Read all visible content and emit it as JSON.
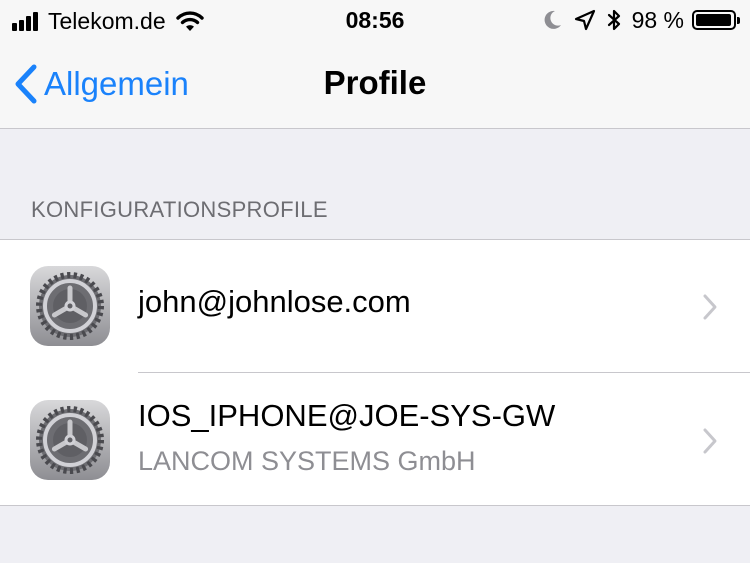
{
  "status_bar": {
    "carrier": "Telekom.de",
    "time": "08:56",
    "battery_percent": "98 %",
    "battery_level": 0.98,
    "icons": [
      "signal-icon",
      "wifi-icon",
      "moon-icon",
      "location-icon",
      "bluetooth-icon",
      "battery-icon"
    ]
  },
  "nav": {
    "back_label": "Allgemein",
    "title": "Profile"
  },
  "section": {
    "header": "KONFIGURATIONSPROFILE"
  },
  "profiles": [
    {
      "title": "john@johnlose.com",
      "subtitle": "",
      "icon": "settings-gear-icon"
    },
    {
      "title": "IOS_IPHONE@JOE-SYS-GW",
      "subtitle": "LANCOM SYSTEMS GmbH",
      "icon": "settings-gear-icon"
    }
  ],
  "colors": {
    "accent": "#1a82fb",
    "background": "#efeff4",
    "nav_background": "#f7f7f7",
    "secondary_text": "#8e8e93",
    "section_header_text": "#6d6d72",
    "separator": "#c8c7cc",
    "chevron": "#c7c7cc"
  }
}
